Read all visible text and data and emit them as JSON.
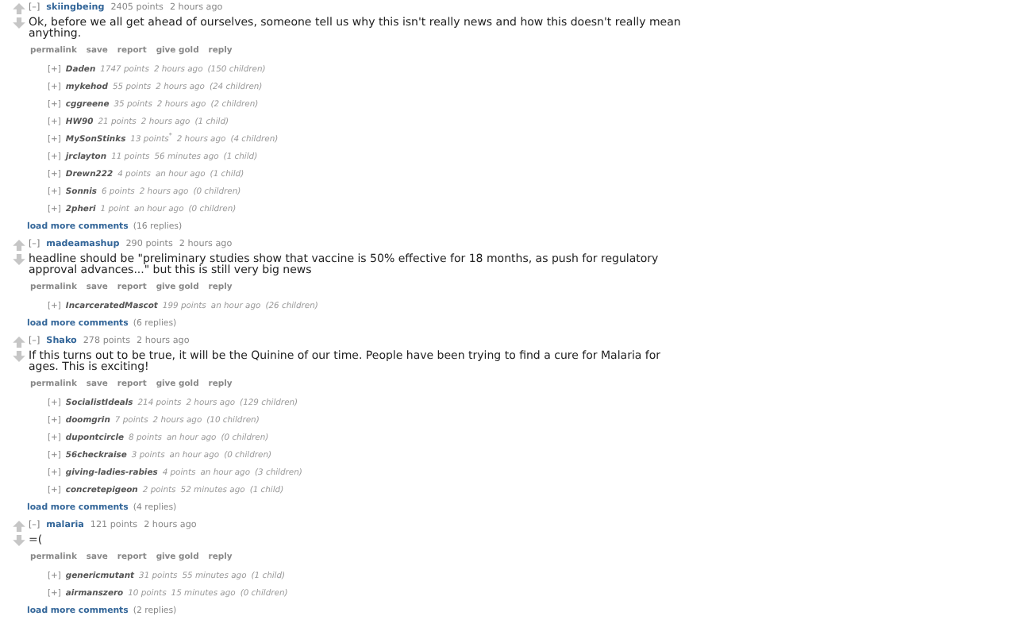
{
  "comments": [
    {
      "toggle": "[–]",
      "author": "skiingbeing",
      "score": "2405 points",
      "time": "2 hours ago",
      "body": "Ok, before we all get ahead of ourselves, someone tell us why this isn't really news and how this doesn't really mean anything.",
      "actions": [
        "permalink",
        "save",
        "report",
        "give gold",
        "reply"
      ],
      "children": [
        {
          "toggle": "[+]",
          "author": "Daden",
          "score": "1747 points",
          "time": "2 hours ago",
          "replies": "(150 children)"
        },
        {
          "toggle": "[+]",
          "author": "mykehod",
          "score": "55 points",
          "time": "2 hours ago",
          "replies": "(24 children)"
        },
        {
          "toggle": "[+]",
          "author": "cggreene",
          "score": "35 points",
          "time": "2 hours ago",
          "replies": "(2 children)"
        },
        {
          "toggle": "[+]",
          "author": "HW90",
          "score": "21 points",
          "time": "2 hours ago",
          "replies": "(1 child)"
        },
        {
          "toggle": "[+]",
          "author": "MySonStinks",
          "score": "13 points$^{*}$",
          "time": "2 hours ago",
          "replies": "(4 children)"
        },
        {
          "toggle": "[+]",
          "author": "jrclayton",
          "score": "11 points",
          "time": "56 minutes ago",
          "replies": "(1 child)"
        },
        {
          "toggle": "[+]",
          "author": "Drewn222",
          "score": "4 points",
          "time": "an hour ago",
          "replies": "(1 child)"
        },
        {
          "toggle": "[+]",
          "author": "Sonnis",
          "score": "6 points",
          "time": "2 hours ago",
          "replies": "(0 children)"
        },
        {
          "toggle": "[+]",
          "author": "2pheri",
          "score": "1 point",
          "time": "an hour ago",
          "replies": "(0 children)"
        }
      ],
      "more": {
        "label": "load more comments",
        "count": "(16 replies)"
      }
    },
    {
      "toggle": "[–]",
      "author": "madeamashup",
      "score": "290 points",
      "time": "2 hours ago",
      "body": "headline should be \"preliminary studies show that vaccine is 50% effective for 18 months, as push for regulatory approval advances...\" but this is still very big news",
      "actions": [
        "permalink",
        "save",
        "report",
        "give gold",
        "reply"
      ],
      "children": [
        {
          "toggle": "[+]",
          "author": "IncarceratedMascot",
          "score": "199 points",
          "time": "an hour ago",
          "replies": "(26 children)"
        }
      ],
      "more": {
        "label": "load more comments",
        "count": "(6 replies)"
      }
    },
    {
      "toggle": "[–]",
      "author": "Shako",
      "score": "278 points",
      "time": "2 hours ago",
      "body": "If this turns out to be true, it will be the Quinine of our time. People have been trying to find a cure for Malaria for ages. This is exciting!",
      "actions": [
        "permalink",
        "save",
        "report",
        "give gold",
        "reply"
      ],
      "children": [
        {
          "toggle": "[+]",
          "author": "SocialistIdeals",
          "score": "214 points",
          "time": "2 hours ago",
          "replies": "(129 children)"
        },
        {
          "toggle": "[+]",
          "author": "doomgrin",
          "score": "7 points",
          "time": "2 hours ago",
          "replies": "(10 children)"
        },
        {
          "toggle": "[+]",
          "author": "dupontcircle",
          "score": "8 points",
          "time": "an hour ago",
          "replies": "(0 children)"
        },
        {
          "toggle": "[+]",
          "author": "56checkraise",
          "score": "3 points",
          "time": "an hour ago",
          "replies": "(0 children)"
        },
        {
          "toggle": "[+]",
          "author": "giving-ladies-rabies",
          "score": "4 points",
          "time": "an hour ago",
          "replies": "(3 children)"
        },
        {
          "toggle": "[+]",
          "author": "concretepigeon",
          "score": "2 points",
          "time": "52 minutes ago",
          "replies": "(1 child)"
        }
      ],
      "more": {
        "label": "load more comments",
        "count": "(4 replies)"
      }
    },
    {
      "toggle": "[–]",
      "author": "malaria",
      "score": "121 points",
      "time": "2 hours ago",
      "body": "=(",
      "actions": [
        "permalink",
        "save",
        "report",
        "give gold",
        "reply"
      ],
      "children": [
        {
          "toggle": "[+]",
          "author": "genericmutant",
          "score": "31 points",
          "time": "55 minutes ago",
          "replies": "(1 child)"
        },
        {
          "toggle": "[+]",
          "author": "airmanszero",
          "score": "10 points",
          "time": "15 minutes ago",
          "replies": "(0 children)"
        }
      ],
      "more": {
        "label": "load more comments",
        "count": "(2 replies)"
      }
    }
  ]
}
